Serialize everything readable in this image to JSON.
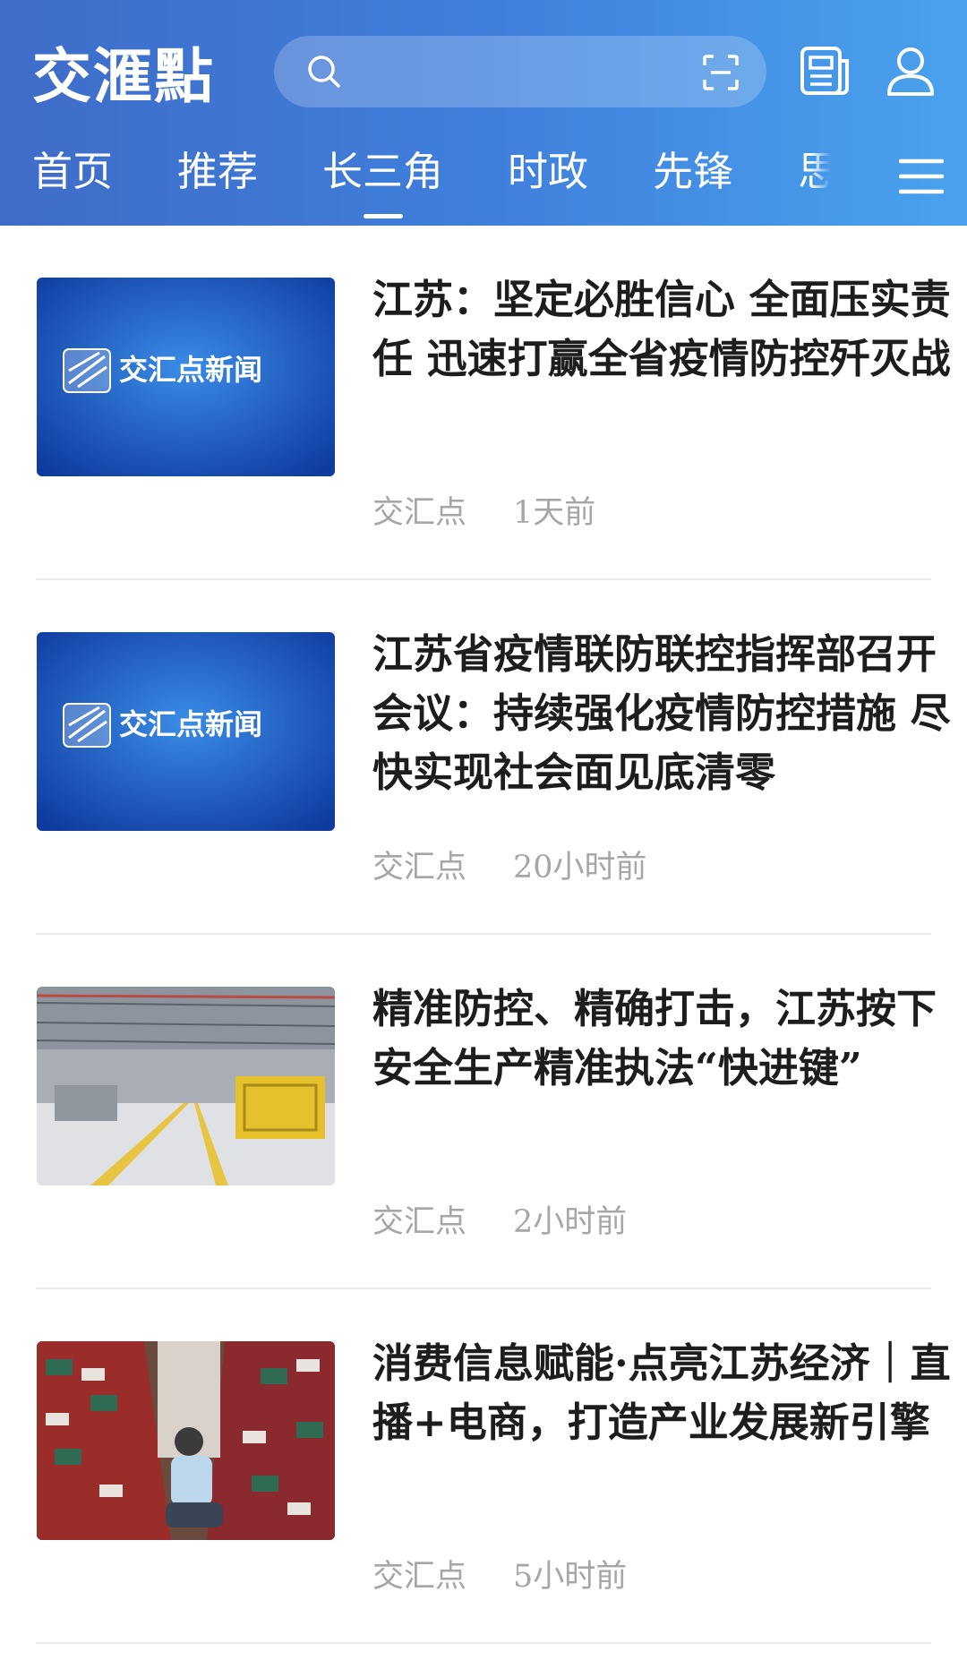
{
  "header": {
    "logo_text": "交滙點",
    "search_placeholder": "",
    "icons": [
      "search-icon",
      "scan-icon",
      "newspaper-icon",
      "user-icon",
      "menu-icon"
    ]
  },
  "tabs": [
    {
      "label": "首页"
    },
    {
      "label": "推荐"
    },
    {
      "label": "长三角",
      "active": true
    },
    {
      "label": "时政"
    },
    {
      "label": "先锋"
    },
    {
      "label": "思想"
    }
  ],
  "articles": [
    {
      "title": "江苏：坚定必胜信心 全面压实责任 迅速打赢全省疫情防控歼灭战",
      "source": "交汇点",
      "time": "1天前",
      "thumb_caption": "交汇点新闻"
    },
    {
      "title": "江苏省疫情联防联控指挥部召开会议：持续强化疫情防控措施 尽快实现社会面见底清零",
      "source": "交汇点",
      "time": "20小时前",
      "thumb_caption": "交汇点新闻"
    },
    {
      "title": "精准防控、精确打击，江苏按下安全生产精准执法“快进键”",
      "source": "交汇点",
      "time": "2小时前",
      "thumb_caption": ""
    },
    {
      "title": "消费信息赋能·点亮江苏经济｜直播+电商，打造产业发展新引擎",
      "source": "交汇点",
      "time": "5小时前",
      "thumb_caption": ""
    }
  ],
  "colors": {
    "header_start": "#3f6cc8",
    "header_end": "#4aa2ee",
    "meta_text": "#a6a6a6"
  }
}
